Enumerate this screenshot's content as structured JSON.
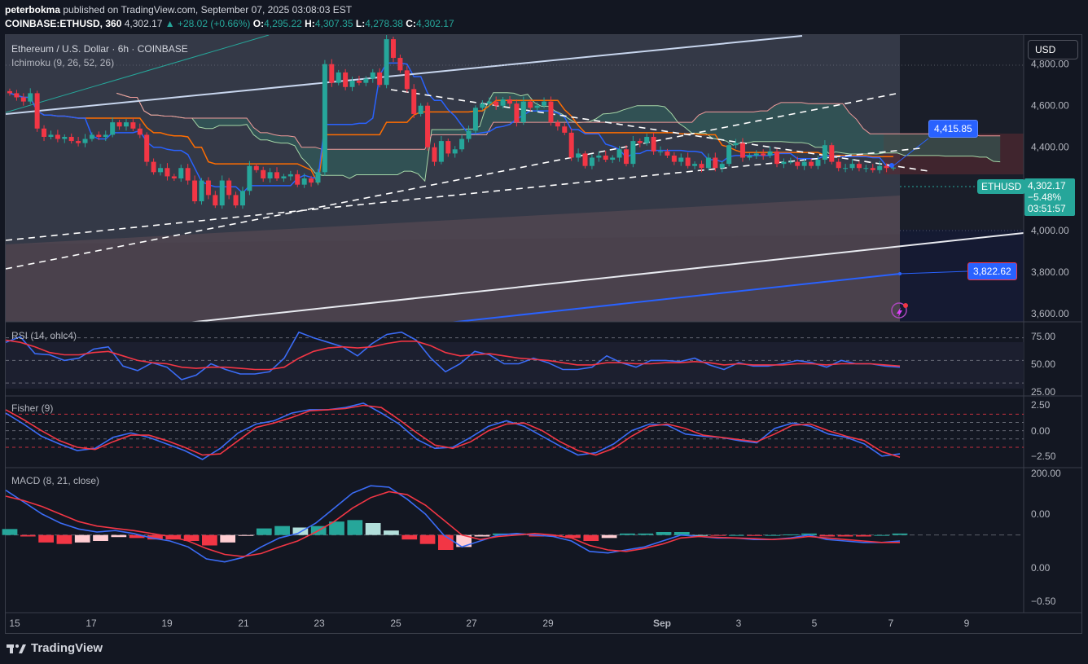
{
  "header": {
    "author": "peterbokma",
    "published_text": "published on TradingView.com, September 07, 2025 03:08:03 EST",
    "symbol_line": "COINBASE:ETHUSD, 360",
    "last": "4,302.17",
    "change": "▲ +28.02 (+0.66%)",
    "o_label": "O:",
    "o": "4,295.22",
    "h_label": "H:",
    "h": "4,307.35",
    "l_label": "L:",
    "l": "4,278.38",
    "c_label": "C:",
    "c": "4,302.17"
  },
  "currency_button": "USD",
  "legend": {
    "main": "Ethereum / U.S. Dollar · 6h · COINBASE",
    "ichimoku": "Ichimoku (9, 26, 52, 26)",
    "rsi": "RSI (14, ohlc4)",
    "fisher": "Fisher (9)",
    "macd": "MACD (8, 21, close)"
  },
  "labels": {
    "upper_target": "4,415.85",
    "lower_target": "3,822.62",
    "symbol_tag": "ETHUSD",
    "price_tag": "4,302.17",
    "change_tag": "−5.48%",
    "countdown": "03:51:57"
  },
  "footer": {
    "brand": "TradingView"
  },
  "colors": {
    "up": "#26a69a",
    "down": "#f23645",
    "bg": "#131722",
    "conversion": "#2962ff",
    "base": "#ff6d00",
    "rsi": "#7e57c2"
  },
  "chart_data": [
    {
      "type": "candlestick",
      "title": "Ethereum / U.S. Dollar · 6h · COINBASE",
      "x_ticks": [
        "15",
        "17",
        "19",
        "21",
        "23",
        "25",
        "27",
        "29",
        "Sep",
        "3",
        "5",
        "7",
        "9"
      ],
      "y_ticks": [
        "4,800.00",
        "4,600.00",
        "4,400.00",
        "4,000.00",
        "3,800.00",
        "3,600.00"
      ],
      "y_tick_values": [
        4800,
        4600,
        4400,
        4000,
        3800,
        3600
      ],
      "ylim": [
        3560,
        4940
      ],
      "last_price": 4302.17,
      "closes": [
        4660,
        4640,
        4620,
        4660,
        4490,
        4450,
        4460,
        4440,
        4450,
        4430,
        4420,
        4440,
        4460,
        4450,
        4460,
        4520,
        4500,
        4520,
        4490,
        4460,
        4330,
        4280,
        4300,
        4260,
        4250,
        4300,
        4240,
        4140,
        4240,
        4170,
        4120,
        4240,
        4170,
        4120,
        4190,
        4310,
        4290,
        4250,
        4280,
        4250,
        4260,
        4270,
        4220,
        4250,
        4230,
        4280,
        4800,
        4710,
        4760,
        4690,
        4720,
        4710,
        4730,
        4760,
        4700,
        4920,
        4830,
        4770,
        4680,
        4560,
        4600,
        4400,
        4330,
        4430,
        4370,
        4390,
        4440,
        4480,
        4590,
        4610,
        4620,
        4600,
        4630,
        4610,
        4520,
        4620,
        4590,
        4600,
        4620,
        4520,
        4500,
        4470,
        4350,
        4370,
        4310,
        4350,
        4360,
        4340,
        4350,
        4390,
        4320,
        4430,
        4420,
        4450,
        4380,
        4380,
        4360,
        4330,
        4350,
        4310,
        4320,
        4300,
        4350,
        4300,
        4320,
        4410,
        4420,
        4350,
        4360,
        4370,
        4360,
        4380,
        4320,
        4330,
        4330,
        4310,
        4330,
        4310,
        4340,
        4410,
        4330,
        4300,
        4300,
        4320,
        4300,
        4300,
        4290,
        4310,
        4300,
        4302
      ]
    },
    {
      "type": "line",
      "title": "RSI (14, ohlc4)",
      "y_ticks": [
        "75.00",
        "50.00",
        "25.00"
      ],
      "ylim": [
        20,
        82
      ],
      "levels": [
        70,
        50,
        30
      ],
      "series": [
        {
          "name": "RSI",
          "values": [
            66,
            71,
            56,
            55,
            50,
            52,
            60,
            62,
            45,
            41,
            48,
            44,
            33,
            37,
            47,
            42,
            38,
            38,
            40,
            52,
            75,
            70,
            66,
            62,
            54,
            65,
            73,
            75,
            68,
            52,
            40,
            47,
            58,
            55,
            47,
            47,
            52,
            48,
            42,
            42,
            44,
            54,
            48,
            44,
            50,
            50,
            49,
            52,
            46,
            42,
            48,
            45,
            45,
            47,
            50,
            48,
            44,
            50,
            47,
            47,
            45,
            44
          ]
        },
        {
          "name": "Smoothing",
          "values": [
            68,
            66,
            62,
            57,
            55,
            55,
            57,
            58,
            54,
            50,
            48,
            47,
            44,
            43,
            44,
            44,
            43,
            42,
            42,
            44,
            52,
            58,
            61,
            62,
            61,
            62,
            65,
            67,
            67,
            63,
            57,
            54,
            55,
            56,
            54,
            52,
            51,
            50,
            48,
            46,
            46,
            48,
            48,
            47,
            47,
            48,
            48,
            49,
            48,
            46,
            47,
            46,
            46,
            46,
            47,
            47,
            46,
            47,
            47,
            47,
            46,
            45
          ]
        }
      ]
    },
    {
      "type": "line",
      "title": "Fisher (9)",
      "y_ticks": [
        "2.50",
        "0.00",
        "−2.50"
      ],
      "ylim": [
        -3.2,
        3.0
      ],
      "levels": [
        1.5,
        0.75,
        0,
        -0.75,
        -1.5
      ],
      "series": [
        {
          "name": "Fisher",
          "values": [
            1.6,
            0.6,
            -0.5,
            -1.2,
            -1.8,
            -1.6,
            -0.6,
            -0.2,
            -0.6,
            -1.2,
            -1.8,
            -2.6,
            -1.6,
            -0.2,
            0.6,
            0.9,
            1.6,
            1.9,
            1.9,
            2.1,
            2.5,
            1.6,
            0.6,
            -0.8,
            -1.6,
            -1.5,
            -0.6,
            0.4,
            0.9,
            0.4,
            -0.5,
            -1.4,
            -2.2,
            -2.0,
            -1.2,
            0.0,
            0.6,
            0.5,
            -0.3,
            -0.5,
            -0.6,
            -0.9,
            -1.1,
            0.2,
            0.7,
            0.4,
            -0.3,
            -0.6,
            -1.2,
            -2.3,
            -2.1
          ]
        },
        {
          "name": "Trigger",
          "values": [
            1.9,
            1.0,
            0.0,
            -0.9,
            -1.5,
            -1.7,
            -1.0,
            -0.4,
            -0.4,
            -0.9,
            -1.5,
            -2.2,
            -2.1,
            -0.9,
            0.3,
            0.7,
            1.2,
            1.8,
            1.9,
            2.0,
            2.3,
            2.1,
            1.0,
            -0.2,
            -1.3,
            -1.6,
            -1.0,
            0.0,
            0.6,
            0.7,
            0.0,
            -1.0,
            -1.8,
            -2.2,
            -1.6,
            -0.5,
            0.4,
            0.6,
            0.2,
            -0.4,
            -0.6,
            -0.8,
            -1.0,
            -0.3,
            0.5,
            0.6,
            0.0,
            -0.5,
            -0.9,
            -1.9,
            -2.4
          ]
        }
      ]
    },
    {
      "type": "bar",
      "title": "MACD (8, 21, close)",
      "y_ticks": [
        "200.00",
        "0.00",
        "0.00",
        "−0.50"
      ],
      "ylim": [
        -260,
        220
      ],
      "series": [
        {
          "name": "MACD",
          "values": [
            150,
            110,
            70,
            40,
            20,
            10,
            15,
            5,
            -10,
            -20,
            -40,
            -80,
            -90,
            -75,
            -40,
            -10,
            5,
            40,
            90,
            140,
            165,
            160,
            120,
            70,
            0,
            -40,
            -20,
            0,
            5,
            0,
            -5,
            -20,
            -55,
            -60,
            -50,
            -40,
            -20,
            0,
            -5,
            -10,
            -10,
            -15,
            -15,
            -10,
            0,
            -15,
            -20,
            -25,
            -25,
            -20
          ]
        },
        {
          "name": "Signal",
          "values": [
            130,
            115,
            95,
            70,
            45,
            30,
            22,
            15,
            5,
            -5,
            -20,
            -45,
            -65,
            -72,
            -62,
            -40,
            -20,
            10,
            45,
            90,
            125,
            145,
            135,
            100,
            50,
            0,
            -15,
            -5,
            0,
            5,
            0,
            -10,
            -35,
            -50,
            -55,
            -45,
            -30,
            -10,
            -5,
            -8,
            -10,
            -12,
            -15,
            -12,
            -5,
            -10,
            -15,
            -20,
            -25,
            -25
          ]
        },
        {
          "name": "Histogram",
          "values": [
            20,
            -5,
            -25,
            -30,
            -25,
            -20,
            -7,
            -10,
            -15,
            -15,
            -20,
            -35,
            -25,
            -3,
            22,
            30,
            25,
            30,
            45,
            50,
            40,
            15,
            -15,
            -30,
            -50,
            -40,
            -5,
            5,
            5,
            -5,
            -5,
            -10,
            -20,
            -10,
            5,
            5,
            10,
            10,
            0,
            -2,
            0,
            -3,
            0,
            2,
            5,
            -5,
            -5,
            -5,
            0,
            5
          ]
        }
      ]
    }
  ]
}
